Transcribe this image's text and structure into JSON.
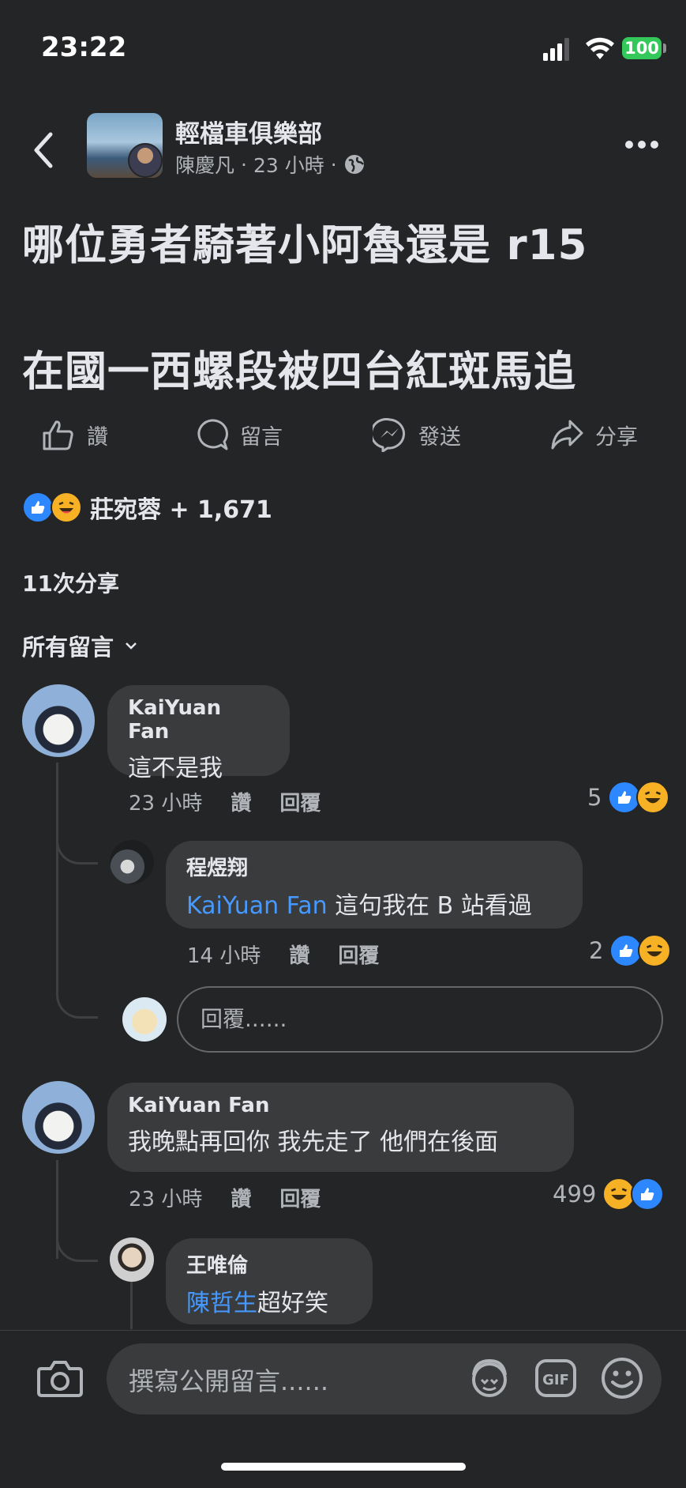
{
  "status_bar": {
    "time": "23:22",
    "battery": "100"
  },
  "header": {
    "group_name": "輕檔車俱樂部",
    "author": "陳慶凡",
    "time": "23 小時"
  },
  "post": {
    "line1": "哪位勇者騎著小阿魯還是 r15",
    "line2": "在國一西螺段被四台紅斑馬追"
  },
  "actions": {
    "like": "讚",
    "comment": "留言",
    "send": "發送",
    "share": "分享"
  },
  "reactions_summary": "莊宛蓉 + 1,671",
  "shares": "11次分享",
  "comments_filter": "所有留言",
  "comments": [
    {
      "author": "KaiYuan Fan",
      "text": "這不是我",
      "time": "23 小時",
      "like_label": "讚",
      "reply_label": "回覆",
      "reaction_count": "5",
      "replies": [
        {
          "author": "程煜翔",
          "mention": "KaiYuan Fan",
          "text": " 這句我在 B 站看過",
          "time": "14 小時",
          "like_label": "讚",
          "reply_label": "回覆",
          "reaction_count": "2"
        }
      ],
      "reply_placeholder": "回覆......"
    },
    {
      "author": "KaiYuan Fan",
      "text": "我晚點再回你 我先走了 他們在後面",
      "time": "23 小時",
      "like_label": "讚",
      "reply_label": "回覆",
      "reaction_count": "499",
      "replies": [
        {
          "author": "王唯倫",
          "mention": "陳哲生",
          "text": "超好笑"
        }
      ]
    }
  ],
  "composer": {
    "placeholder": "撰寫公開留言......"
  },
  "colors": {
    "background": "#242526",
    "bubble": "#3a3b3c",
    "accent": "#4599ff",
    "like": "#2d88ff",
    "haha": "#f7b125"
  }
}
